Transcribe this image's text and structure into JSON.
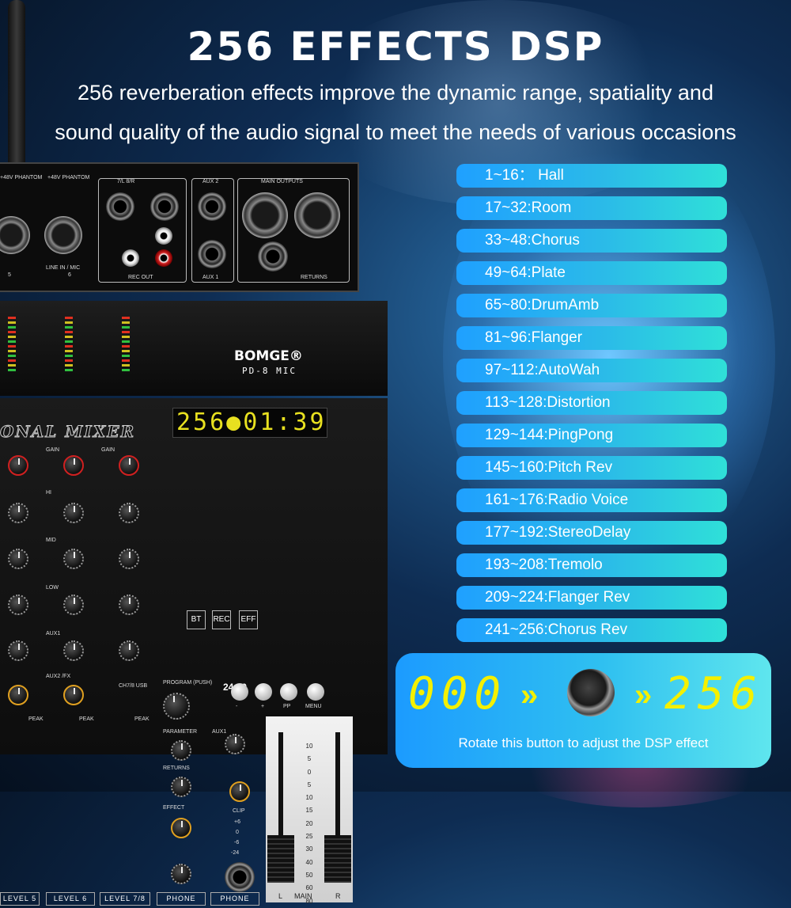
{
  "headline": "256 EFFECTS DSP",
  "subtitle_line1": "256 reverberation effects improve the dynamic range, spatiality and",
  "subtitle_line2": "sound quality of the audio signal to meet the needs of various occasions",
  "effects": [
    "1~16： Hall",
    "17~32:Room",
    "33~48:Chorus",
    "49~64:Plate",
    "65~80:DrumAmb",
    "81~96:Flanger",
    "97~112:AutoWah",
    "113~128:Distortion",
    "129~144:PingPong",
    "145~160:Pitch Rev",
    "161~176:Radio Voice",
    "177~192:StereoDelay",
    "193~208:Tremolo",
    "209~224:Flanger Rev",
    "241~256:Chorus Rev"
  ],
  "dsp": {
    "start": "000",
    "end": "256",
    "caption": "Rotate this button to adjust the DSP effect"
  },
  "mixer": {
    "brand": "BOMGE®",
    "model": "PD-8 MIC",
    "title": "ONAL MIXER",
    "display": "256●01:39",
    "rate": "24 40",
    "top_labels": {
      "phantom1": "+48V PHANTOM",
      "phantom2": "+48V PHANTOM",
      "lr78": "7/L      8/R",
      "aux2": "AUX 2",
      "main_outputs": "MAIN OUTPUTS",
      "rec_out": "REC OUT",
      "aux1": "AUX 1",
      "returns": "RETURNS",
      "ch5": "5",
      "ch6": "6",
      "line_mic": "LINE IN / MIC"
    },
    "buttons": [
      "BT",
      "REC",
      "EFF"
    ],
    "knob_labels": {
      "gain": "GAIN",
      "hi": "HI",
      "mid": "MID",
      "low": "LOW",
      "aux1": "AUX1",
      "aux2fx": "AUX2 /FX",
      "program": "PROGRAM (PUSH)",
      "parameter": "PARAMETER",
      "returns": "RETURNS",
      "effect": "EFFECT",
      "clip": "CLIP",
      "ch78usb": "CH7/8 USB",
      "peak": "PEAK"
    },
    "pp_buttons": [
      "-",
      "+",
      "PP",
      "MENU"
    ],
    "channel_labels": [
      "LEVEL 5",
      "LEVEL 6",
      "LEVEL 7/8",
      "PHONE",
      "PHONE"
    ],
    "fader_labels": {
      "left": "L",
      "main": "MAIN",
      "right": "R"
    },
    "fader_scale": [
      "10",
      "5",
      "0",
      "5",
      "10",
      "15",
      "20",
      "25",
      "30",
      "40",
      "50",
      "60",
      "80"
    ],
    "vu_scale": [
      "+6",
      "0",
      "-6",
      "-24"
    ]
  }
}
